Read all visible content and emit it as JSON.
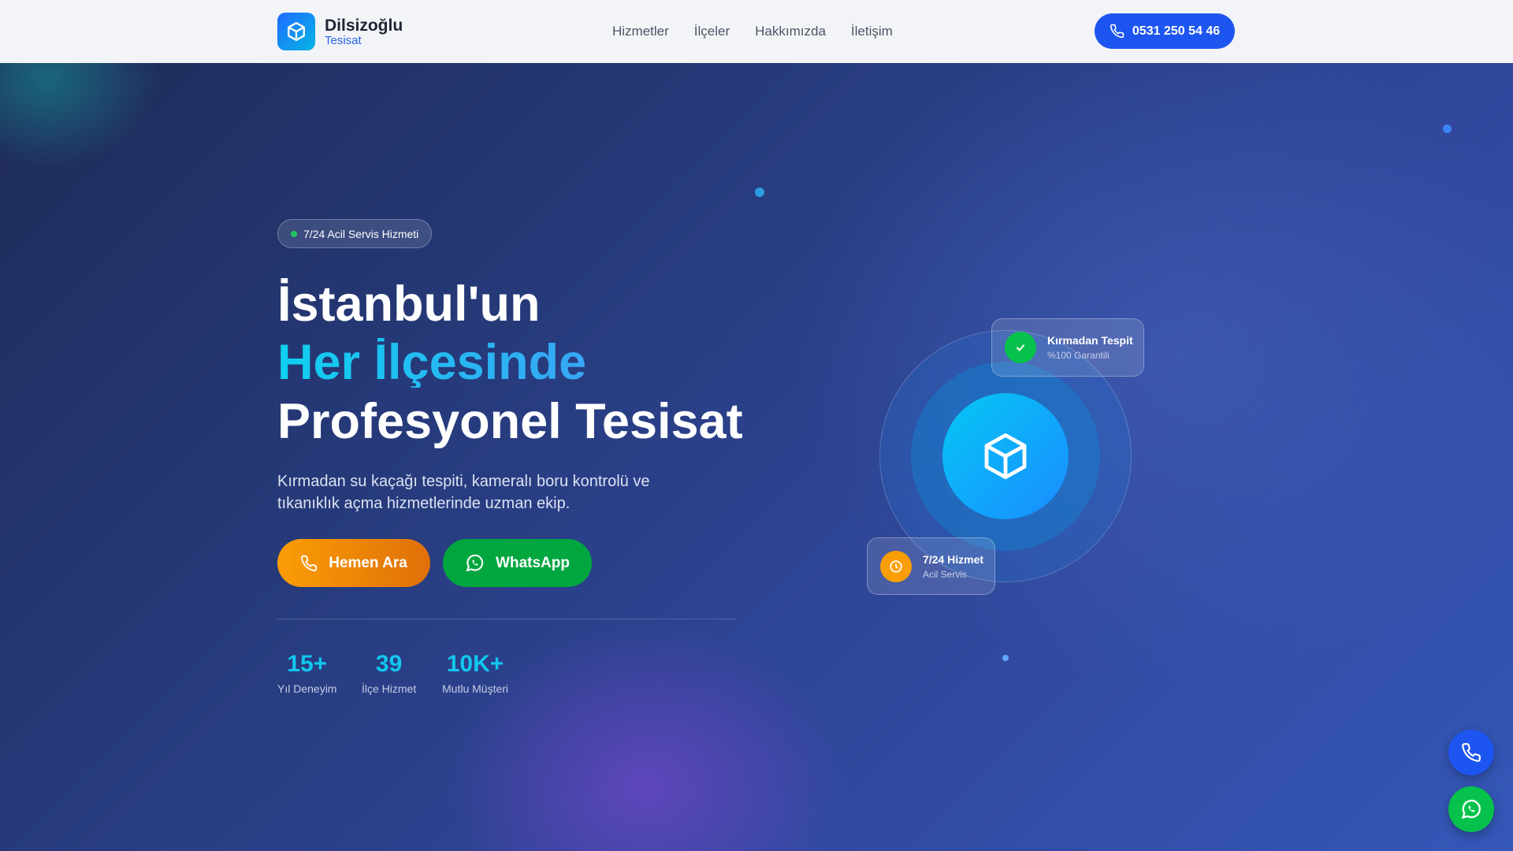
{
  "nav": {
    "brand": "Dilsizoğlu",
    "brand_sub": "Tesisat",
    "links": [
      "Hizmetler",
      "İlçeler",
      "Hakkımızda",
      "İletişim"
    ],
    "phone": "0531 250 54 46"
  },
  "hero": {
    "badge": "7/24 Acil Servis Hizmeti",
    "line1": "İstanbul'un",
    "line2": "Her İlçesinde",
    "line3": "Profesyonel Tesisat",
    "description": "Kırmadan su kaçağı tespiti, kameralı boru kontrolü ve tıkanıklık açma hizmetlerinde uzman ekip.",
    "call_label": "Hemen Ara",
    "whatsapp_label": "WhatsApp"
  },
  "stats": [
    {
      "value": "15+",
      "label": "Yıl Deneyim"
    },
    {
      "value": "39",
      "label": "İlçe Hizmet"
    },
    {
      "value": "10K+",
      "label": "Mutlu Müşteri"
    }
  ],
  "cards": {
    "c1_title": "Kırmadan Tespit",
    "c1_sub": "%100 Garantili",
    "c2_title": "7/24 Hizmet",
    "c2_sub": "Acil Servis"
  },
  "colors": {
    "accent": "#1d55f0",
    "orange": "#fb9d06",
    "green": "#01a63f",
    "cyan": "#12c6ee"
  }
}
